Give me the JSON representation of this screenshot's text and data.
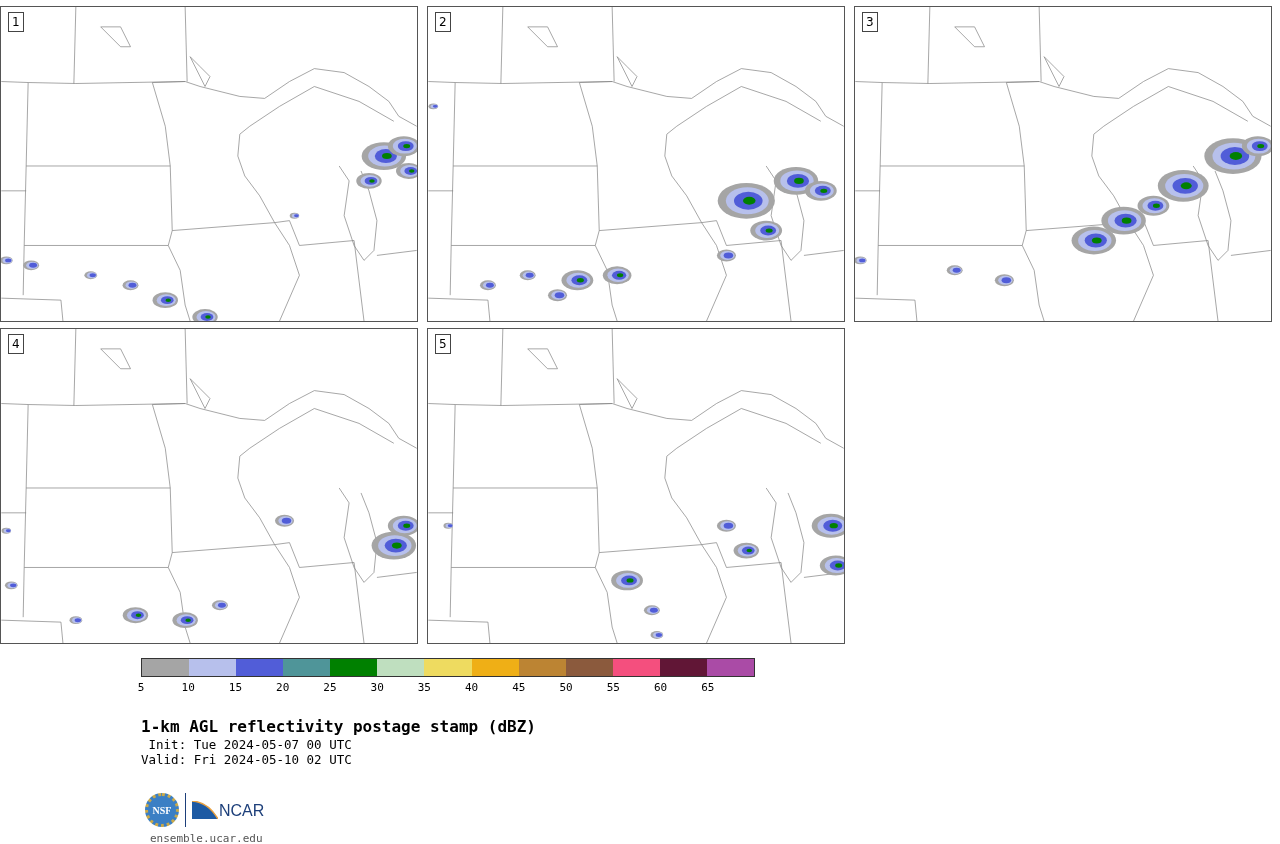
{
  "panels": [
    {
      "label": "1"
    },
    {
      "label": "2"
    },
    {
      "label": "3"
    },
    {
      "label": "4"
    },
    {
      "label": "5"
    }
  ],
  "colorbar": {
    "swatches": [
      {
        "color": "#a5a5a5"
      },
      {
        "color": "#b7c0ec"
      },
      {
        "color": "#515dd8"
      },
      {
        "color": "#4f9599"
      },
      {
        "color": "#008000"
      },
      {
        "color": "#bfdfbf"
      },
      {
        "color": "#eedb60"
      },
      {
        "color": "#efaf16"
      },
      {
        "color": "#bc8433"
      },
      {
        "color": "#8b5a3d"
      },
      {
        "color": "#f44f7e"
      },
      {
        "color": "#611636"
      },
      {
        "color": "#aa4ba6"
      }
    ],
    "ticks": [
      "5",
      "10",
      "15",
      "20",
      "25",
      "30",
      "35",
      "40",
      "45",
      "50",
      "55",
      "60",
      "65"
    ]
  },
  "title": "1-km AGL reflectivity postage stamp (dBZ)",
  "init": " Init: Tue 2024-05-07 00 UTC",
  "valid": "Valid: Fri 2024-05-10 02 UTC",
  "logos": {
    "nsf": "NSF",
    "ncar": "NCAR"
  },
  "url": "ensemble.ucar.edu"
}
